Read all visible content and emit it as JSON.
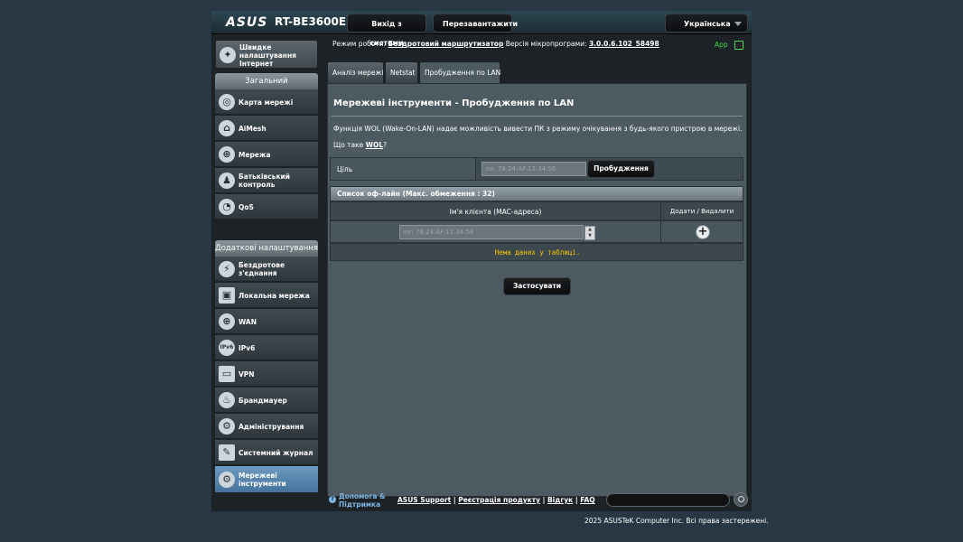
{
  "header": {
    "logo": "ASUS",
    "model": "RT-BE3600E",
    "logout_label": "Вихід з системи",
    "reboot_label": "Перезавантажити",
    "language": "Українська"
  },
  "status": {
    "opmode_prefix": "Режим роботи:",
    "opmode_value": "Бездротовий маршрутизатор",
    "firmware_prefix": "Версія мікропрограми:",
    "firmware_value": "3.0.0.6.102_58498",
    "app_label": "App"
  },
  "sidebar": {
    "quick_setup": "Швидке налаштування Інтернет",
    "general_header": "Загальний",
    "general_items": [
      {
        "label": "Карта мережі"
      },
      {
        "label": "AiMesh"
      },
      {
        "label": "Мережа"
      },
      {
        "label": "Батьківський контроль"
      },
      {
        "label": "QoS"
      }
    ],
    "advanced_header": "Додаткові налаштування",
    "advanced_items": [
      {
        "label": "Бездротове з'єднання"
      },
      {
        "label": "Локальна мережа"
      },
      {
        "label": "WAN"
      },
      {
        "label": "IPv6"
      },
      {
        "label": "VPN"
      },
      {
        "label": "Брандмауер"
      },
      {
        "label": "Адміністрування"
      },
      {
        "label": "Системний журнал"
      },
      {
        "label": "Мережеві інструменти"
      }
    ]
  },
  "tabs": [
    {
      "label": "Аналіз мережі"
    },
    {
      "label": "Netstat"
    },
    {
      "label": "Пробудження по LAN"
    }
  ],
  "main": {
    "title": "Мережеві інструменти - Пробудження по LAN",
    "description": "Функція WOL (Wake-On-LAN) надає можливість вивести ПК з режиму очікування з будь-якого пристрою в мережі.",
    "wol_question_prefix": "Що таке",
    "wol_link": "WOL",
    "wol_question_suffix": "?",
    "target_label": "Ціль",
    "target_placeholder": "ex: 78:24:AF:12:34:56",
    "wake_button": "Пробудження",
    "offline_list_header": "Список оф-лайн (Макс. обмеження : 32)",
    "col_client": "Ім'я клієнта (MAC-адреса)",
    "col_actions": "Додати / Видалити",
    "client_placeholder": "ex: 78:24:AF:12:34:56",
    "empty_message": "Нема даних у таблиці.",
    "apply_button": "Застосувати"
  },
  "footer": {
    "help_line1": "Допомога &",
    "help_line2": "Підтримка",
    "links": [
      "ASUS Support",
      "Реєстрація продукту",
      "Відгук",
      "FAQ"
    ],
    "copyright": "2025 ASUSTeK Computer Inc. Всі права застережені."
  }
}
